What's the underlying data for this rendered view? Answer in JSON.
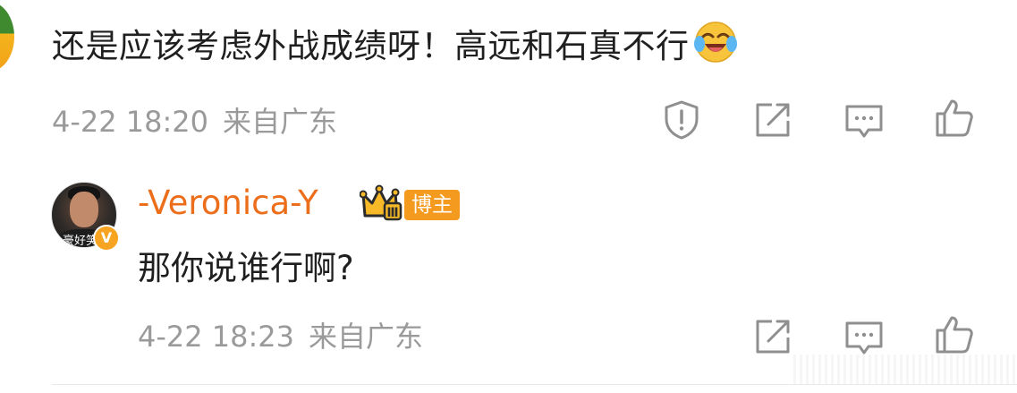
{
  "comment": {
    "text": "还是应该考虑外战成绩呀！高远和石真不行",
    "emoji": "laughing-crying-emoji",
    "date": "4-22 18:20",
    "location": "来自广东",
    "actions": [
      "report-icon",
      "share-icon",
      "comment-icon",
      "like-icon"
    ]
  },
  "reply": {
    "username": "-Veronica-Y",
    "badge_level": "Ⅲ",
    "badge_label": "博主",
    "avatar_caption": "豪好笑",
    "verified_mark": "V",
    "text": "那你说谁行啊?",
    "date": "4-22 18:23",
    "location": "来自广东",
    "actions": [
      "share-icon",
      "comment-icon",
      "like-icon"
    ]
  },
  "colors": {
    "username": "#ec6e1a",
    "badge": "#f49b1f",
    "meta": "#9a9a9a",
    "icon": "#8f8f8f"
  }
}
